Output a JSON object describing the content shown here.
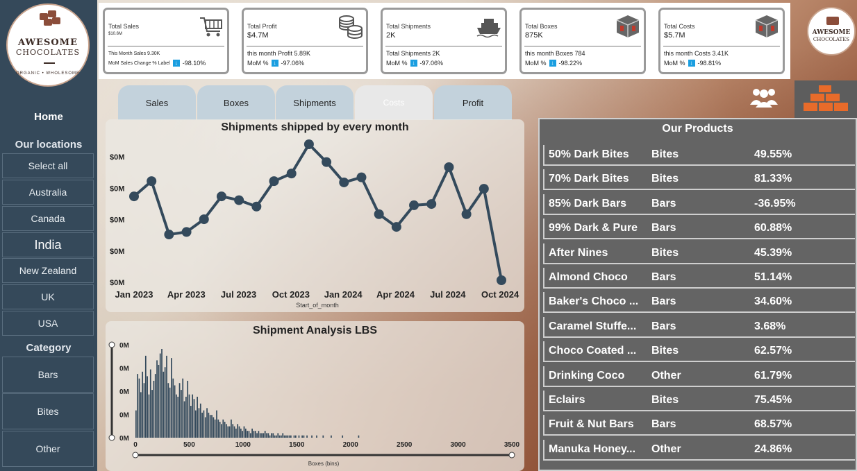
{
  "brand": {
    "name_line1": "AWESOME",
    "name_line2": "CHOCOLATES",
    "tagline": "ORGANIC • WHOLESOME"
  },
  "sidebar": {
    "home": "Home",
    "locations_title": "Our locations",
    "locations": [
      "Select all",
      "Australia",
      "Canada",
      "India",
      "New Zealand",
      "UK",
      "USA"
    ],
    "active_location": "India",
    "category_title": "Category",
    "categories": [
      "Bars",
      "Bites",
      "Other"
    ]
  },
  "kpis": [
    {
      "title": "Total Sales",
      "value": "$10.6M",
      "month": "This Month Sales 9.30K",
      "mom_label": "MoM Sales Change % Label",
      "mom": "-98.10%",
      "icon": "cart-icon"
    },
    {
      "title": "Total Profit",
      "value": "$4.7M",
      "month": "this month Profit 5.89K",
      "mom_label": "MoM %",
      "mom": "-97.06%",
      "icon": "coins-icon"
    },
    {
      "title": "Total Shipments",
      "value": "2K",
      "month": "Total Shipments 2K",
      "mom_label": "MoM %",
      "mom": "-97.06%",
      "icon": "ship-icon"
    },
    {
      "title": "Total Boxes",
      "value": "875K",
      "month": "this month Boxes 784",
      "mom_label": "MoM %",
      "mom": "-98.22%",
      "icon": "box-icon"
    },
    {
      "title": "Total Costs",
      "value": "$5.7M",
      "month": "this month Costs 3.41K",
      "mom_label": "MoM %",
      "mom": "-98.81%",
      "icon": "box-icon"
    }
  ],
  "tabs": [
    "Sales",
    "Boxes",
    "Shipments",
    "Costs",
    "Profit"
  ],
  "active_tab": "Costs",
  "products": {
    "title": "Our Products",
    "rows": [
      {
        "name": "50% Dark Bites",
        "category": "Bites",
        "pct": "49.55%"
      },
      {
        "name": "70% Dark Bites",
        "category": "Bites",
        "pct": "81.33%"
      },
      {
        "name": "85% Dark Bars",
        "category": "Bars",
        "pct": "-36.95%"
      },
      {
        "name": "99% Dark & Pure",
        "category": "Bars",
        "pct": "60.88%"
      },
      {
        "name": "After Nines",
        "category": "Bites",
        "pct": "45.39%"
      },
      {
        "name": "Almond Choco",
        "category": "Bars",
        "pct": "51.14%"
      },
      {
        "name": "Baker's Choco ...",
        "category": "Bars",
        "pct": "34.60%"
      },
      {
        "name": "Caramel Stuffe...",
        "category": "Bars",
        "pct": "3.68%"
      },
      {
        "name": "Choco Coated ...",
        "category": "Bites",
        "pct": "62.57%"
      },
      {
        "name": "Drinking Coco",
        "category": "Other",
        "pct": "61.79%"
      },
      {
        "name": "Eclairs",
        "category": "Bites",
        "pct": "75.45%"
      },
      {
        "name": "Fruit & Nut Bars",
        "category": "Bars",
        "pct": "68.57%"
      },
      {
        "name": "Manuka Honey...",
        "category": "Other",
        "pct": "24.86%"
      }
    ]
  },
  "chart_data": [
    {
      "type": "line",
      "title": "Shipments shipped by every month",
      "xlabel": "Start_of_month",
      "ylabel": "",
      "x_tick_labels": [
        "Jan 2023",
        "Apr 2023",
        "Jul 2023",
        "Oct 2023",
        "Jan 2024",
        "Apr 2024",
        "Jul 2024",
        "Oct 2024"
      ],
      "y_tick_labels": [
        "$0M",
        "$0M",
        "$0M",
        "$0M",
        "$0M"
      ],
      "x": [
        "2023-01",
        "2023-02",
        "2023-03",
        "2023-04",
        "2023-05",
        "2023-06",
        "2023-07",
        "2023-08",
        "2023-09",
        "2023-10",
        "2023-11",
        "2023-12",
        "2024-01",
        "2024-02",
        "2024-03",
        "2024-04",
        "2024-05",
        "2024-06",
        "2024-07",
        "2024-08",
        "2024-09",
        "2024-10"
      ],
      "values": [
        0.66,
        0.78,
        0.36,
        0.38,
        0.48,
        0.66,
        0.63,
        0.58,
        0.78,
        0.84,
        1.07,
        0.93,
        0.77,
        0.81,
        0.52,
        0.42,
        0.59,
        0.6,
        0.89,
        0.52,
        0.72,
        0.0
      ],
      "grid": false,
      "color": "#344a5c"
    },
    {
      "type": "bar",
      "title": "Shipment Analysis LBS",
      "xlabel": "Boxes (bins)",
      "ylabel": "",
      "x_tick_labels": [
        "0",
        "500",
        "1000",
        "1500",
        "2000",
        "2500",
        "3000",
        "3500"
      ],
      "y_tick_labels": [
        "0M",
        "0M",
        "0M",
        "0M",
        "0M"
      ],
      "xlim": [
        0,
        3500
      ],
      "bin_width": 15,
      "values": [
        1.2,
        2.8,
        2.6,
        2.0,
        2.9,
        2.4,
        3.6,
        2.7,
        1.9,
        3.0,
        2.1,
        2.5,
        2.8,
        3.4,
        3.2,
        3.7,
        3.9,
        2.9,
        3.1,
        3.6,
        2.4,
        2.2,
        3.5,
        2.6,
        2.3,
        1.9,
        1.8,
        2.4,
        2.1,
        2.6,
        1.6,
        1.8,
        2.5,
        1.9,
        1.4,
        1.9,
        1.7,
        1.2,
        1.8,
        1.3,
        1.5,
        1.1,
        1.2,
        0.9,
        1.3,
        1.1,
        1.0,
        1.0,
        0.9,
        0.8,
        1.2,
        0.8,
        0.7,
        0.6,
        0.8,
        0.7,
        0.6,
        0.5,
        0.5,
        0.8,
        0.6,
        0.5,
        0.4,
        0.6,
        0.5,
        0.4,
        0.3,
        0.5,
        0.4,
        0.3,
        0.3,
        0.2,
        0.4,
        0.3,
        0.3,
        0.2,
        0.3,
        0.2,
        0.2,
        0.2,
        0.3,
        0.2,
        0.2,
        0.1,
        0.2,
        0.2,
        0.1,
        0.1,
        0.2,
        0.1,
        0.1,
        0.2,
        0.1,
        0.1,
        0.1,
        0.1,
        0.1,
        0.0,
        0.1,
        0.1,
        0.0,
        0.1,
        0.0,
        0.1,
        0.1,
        0.0,
        0.1,
        0.0,
        0.0,
        0.1,
        0.0,
        0.0,
        0.1,
        0.0,
        0.0,
        0.0,
        0.1,
        0.0,
        0.0,
        0.0,
        0.0,
        0.1,
        0.0,
        0.0,
        0.0,
        0.0,
        0.0,
        0.0,
        0.1,
        0.0,
        0.0,
        0.0,
        0.0,
        0.0,
        0.0,
        0.0,
        0.0,
        0.0,
        0.1,
        0.0,
        0.0,
        0.0,
        0.0,
        0.0,
        0.0,
        0.0,
        0.0,
        0.0,
        0.0,
        0.0,
        0.0,
        0.0,
        0.0,
        0.0,
        0.0,
        0.0,
        0.0,
        0.0,
        0.0,
        0.0,
        0.0,
        0.0,
        0.0,
        0.0,
        0.0,
        0.0,
        0.0,
        0.0,
        0.0,
        0.0,
        0.0,
        0.0,
        0.0,
        0.0,
        0.0,
        0.0,
        0.0,
        0.0,
        0.0,
        0.0,
        0.0,
        0.0,
        0.0,
        0.0,
        0.0,
        0.0,
        0.0,
        0.0,
        0.0,
        0.0,
        0.0,
        0.0,
        0.0,
        0.0,
        0.0,
        0.0,
        0.0,
        0.0,
        0.0,
        0.0,
        0.0,
        0.0,
        0.0,
        0.0,
        0.0,
        0.0,
        0.0,
        0.0,
        0.0,
        0.0,
        0.0,
        0.0,
        0.0,
        0.0,
        0.0,
        0.0,
        0.0,
        0.0,
        0.0
      ],
      "grid": false,
      "color": "#344a5c"
    }
  ],
  "colors": {
    "sidebar": "#35495a",
    "accent": "#344a5c",
    "mom_arrow": "#1a9ee0",
    "boxes_tile": "#e86b2a",
    "table_bg": "#646464"
  }
}
